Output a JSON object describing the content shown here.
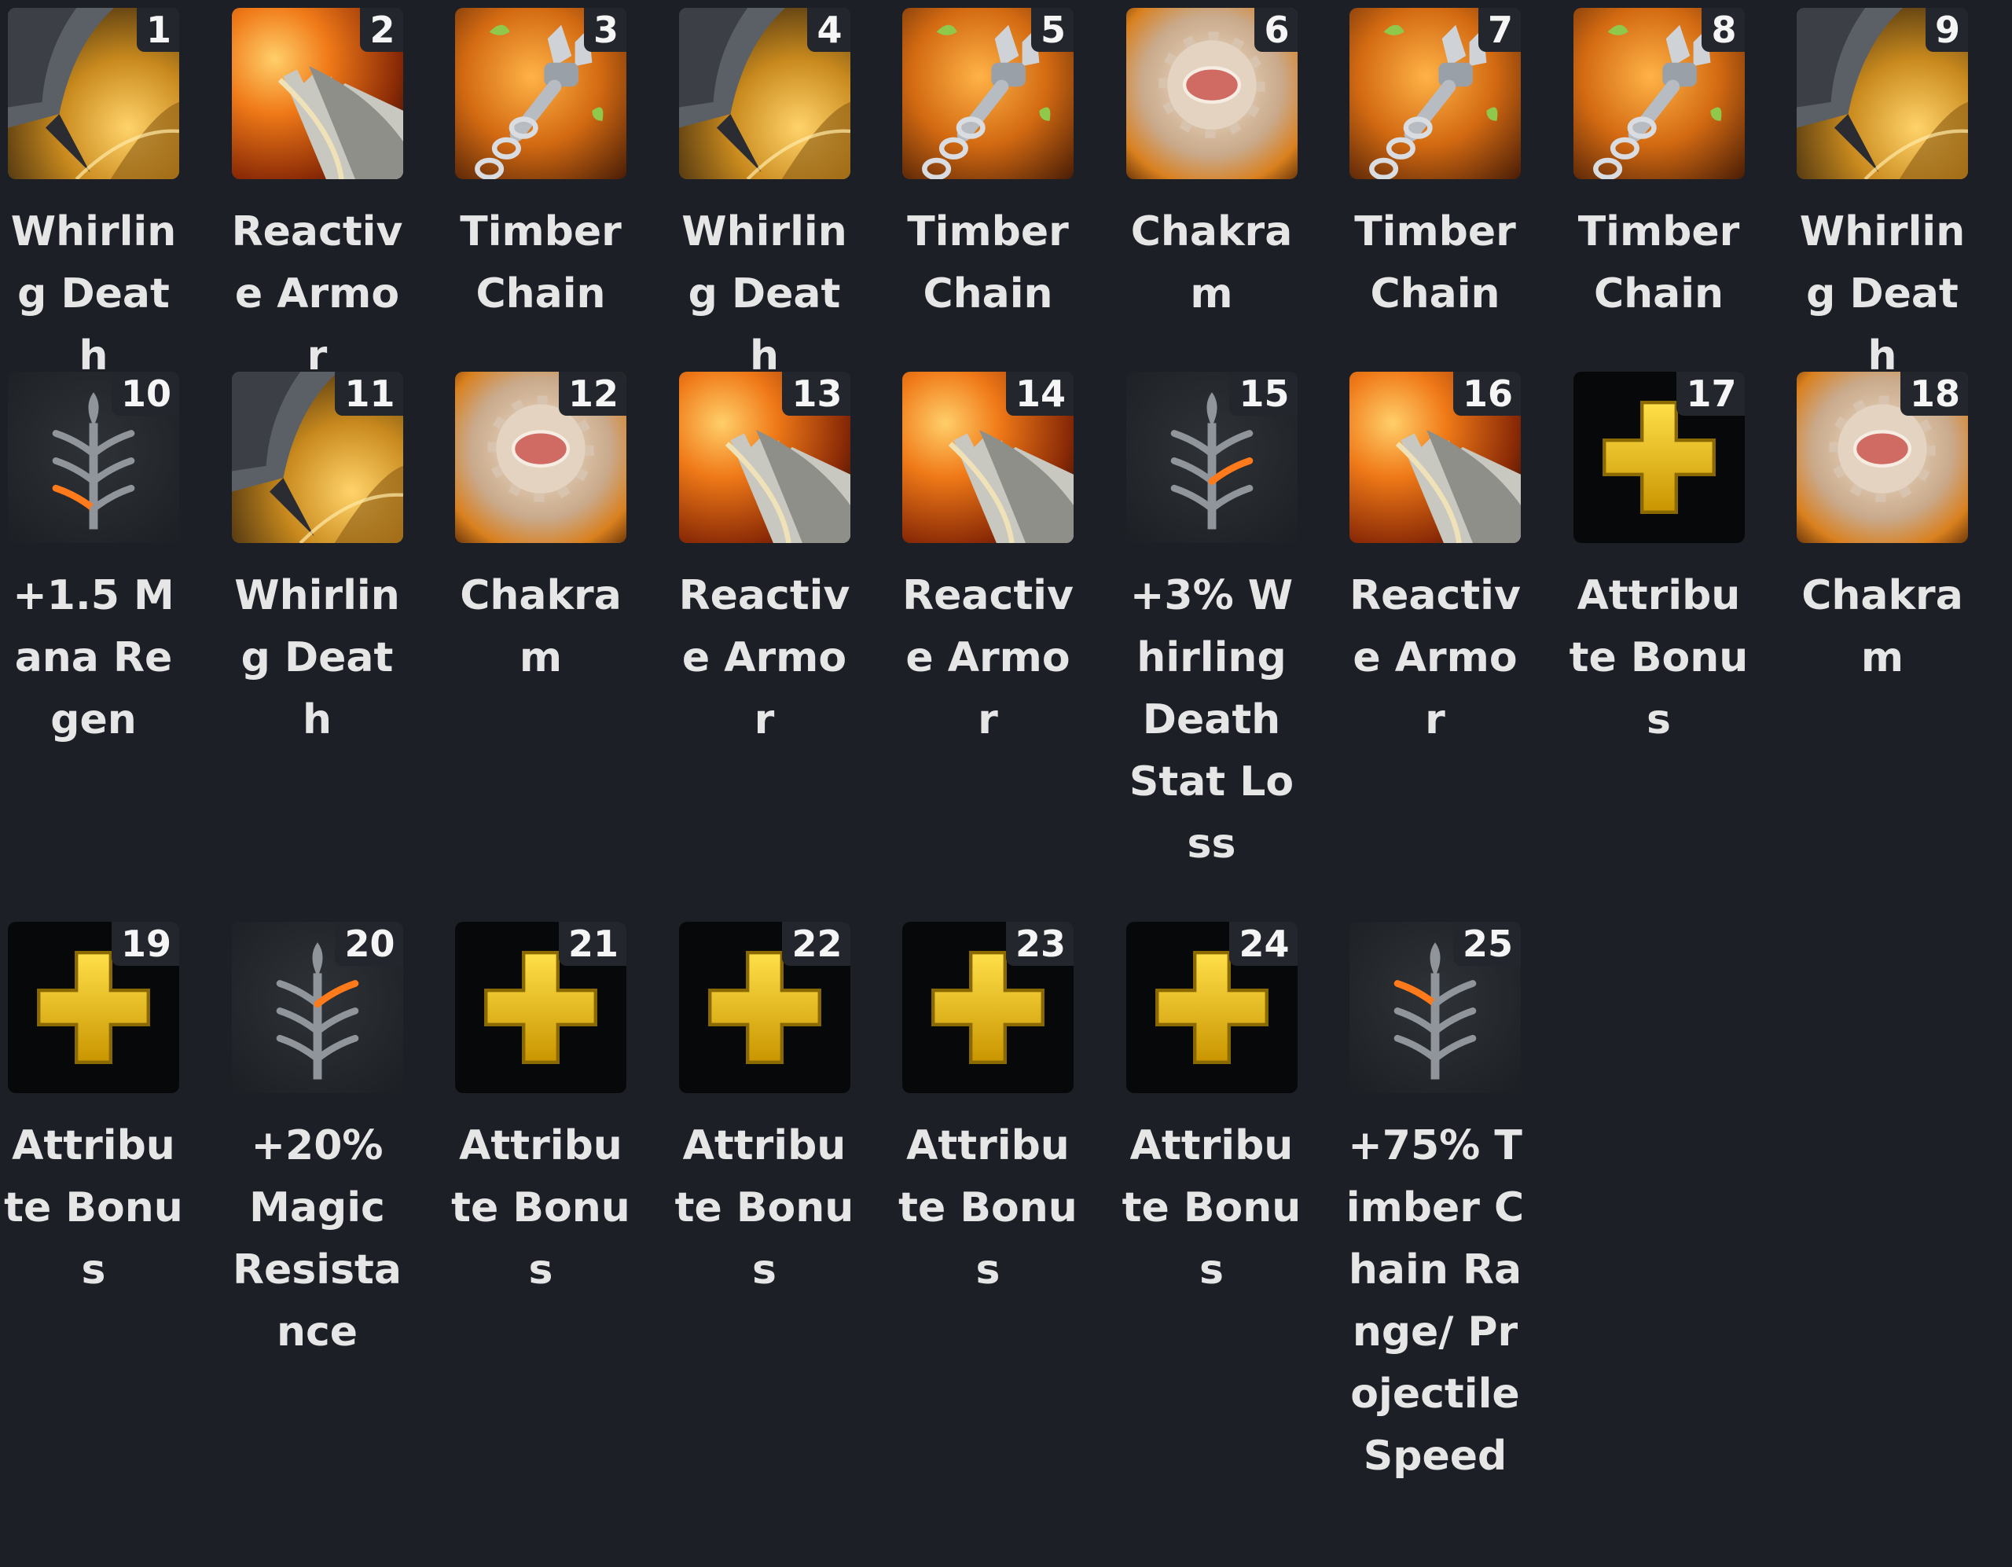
{
  "skills": [
    {
      "level": "1",
      "name": "Whirling Death",
      "icon": "whirling-death"
    },
    {
      "level": "2",
      "name": "Reactive Armor",
      "icon": "reactive-armor"
    },
    {
      "level": "3",
      "name": "Timber Chain",
      "icon": "timber-chain"
    },
    {
      "level": "4",
      "name": "Whirling Death",
      "icon": "whirling-death"
    },
    {
      "level": "5",
      "name": "Timber Chain",
      "icon": "timber-chain"
    },
    {
      "level": "6",
      "name": "Chakram",
      "icon": "chakram"
    },
    {
      "level": "7",
      "name": "Timber Chain",
      "icon": "timber-chain"
    },
    {
      "level": "8",
      "name": "Timber Chain",
      "icon": "timber-chain"
    },
    {
      "level": "9",
      "name": "Whirling Death",
      "icon": "whirling-death"
    },
    {
      "level": "10",
      "name": "+1.5 Mana Regen",
      "icon": "talent-tree"
    },
    {
      "level": "11",
      "name": "Whirling Death",
      "icon": "whirling-death"
    },
    {
      "level": "12",
      "name": "Chakram",
      "icon": "chakram"
    },
    {
      "level": "13",
      "name": "Reactive Armor",
      "icon": "reactive-armor"
    },
    {
      "level": "14",
      "name": "Reactive Armor",
      "icon": "reactive-armor"
    },
    {
      "level": "15",
      "name": "+3% Whirling Death Stat Loss",
      "icon": "talent-tree"
    },
    {
      "level": "16",
      "name": "Reactive Armor",
      "icon": "reactive-armor"
    },
    {
      "level": "17",
      "name": "Attribute Bonus",
      "icon": "attribute-plus"
    },
    {
      "level": "18",
      "name": "Chakram",
      "icon": "chakram"
    },
    {
      "level": "19",
      "name": "Attribute Bonus",
      "icon": "attribute-plus"
    },
    {
      "level": "20",
      "name": "+20% Magic Resistance",
      "icon": "talent-tree"
    },
    {
      "level": "21",
      "name": "Attribute Bonus",
      "icon": "attribute-plus"
    },
    {
      "level": "22",
      "name": "Attribute Bonus",
      "icon": "attribute-plus"
    },
    {
      "level": "23",
      "name": "Attribute Bonus",
      "icon": "attribute-plus"
    },
    {
      "level": "24",
      "name": "Attribute Bonus",
      "icon": "attribute-plus"
    },
    {
      "level": "25",
      "name": "+75% Timber Chain Range/ Projectile Speed",
      "icon": "talent-tree"
    }
  ],
  "colors": {
    "background": "#1c1f25",
    "label": "#e6e6e6",
    "attribute_plus": "#f2c200",
    "talent_highlight": "#ff7a1a"
  }
}
